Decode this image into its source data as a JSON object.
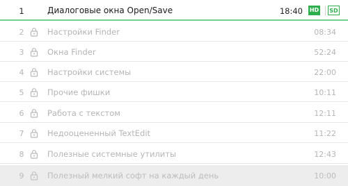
{
  "lessons": {
    "active": {
      "number": "1",
      "title": "Диалоговые окна Open/Save",
      "duration": "18:40",
      "quality": [
        "HD",
        "SD"
      ]
    },
    "locked": [
      {
        "number": "2",
        "title": "Настройки Finder",
        "duration": "08:34"
      },
      {
        "number": "3",
        "title": "Окна Finder",
        "duration": "52:24"
      },
      {
        "number": "4",
        "title": "Настройки системы",
        "duration": "22:00"
      },
      {
        "number": "5",
        "title": "Прочие фишки",
        "duration": "10:11"
      },
      {
        "number": "6",
        "title": "Работа с текстом",
        "duration": "12:11"
      },
      {
        "number": "7",
        "title": "Недооцененный TextEdit",
        "duration": "11:22"
      },
      {
        "number": "8",
        "title": "Полезные системные утилиты",
        "duration": "12:43"
      },
      {
        "number": "9",
        "title": "Полезный мелкий софт на каждый день",
        "duration": "10:00"
      }
    ]
  },
  "colors": {
    "accent": "#2fae4e",
    "active_border": "#6fcf8c",
    "locked_text": "#b5b5b5",
    "hover_row": "#ededed"
  }
}
